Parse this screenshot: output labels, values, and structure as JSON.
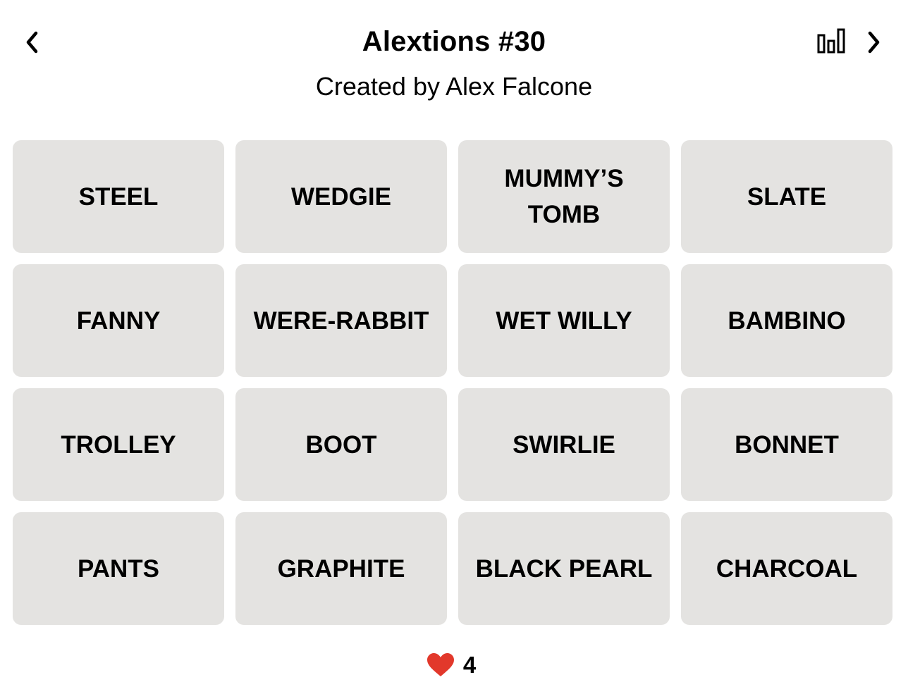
{
  "header": {
    "title": "Alextions #30",
    "subtitle": "Created by Alex Falcone",
    "prev_icon": "chevron-left-icon",
    "next_icon": "chevron-right-icon",
    "stats_icon": "bar-chart-icon"
  },
  "tiles": [
    "STEEL",
    "WEDGIE",
    "MUMMY’S TOMB",
    "SLATE",
    "FANNY",
    "WERE-RABBIT",
    "WET WILLY",
    "BAMBINO",
    "TROLLEY",
    "BOOT",
    "SWIRLIE",
    "BONNET",
    "PANTS",
    "GRAPHITE",
    "BLACK PEARL",
    "CHARCOAL"
  ],
  "lives": {
    "icon": "heart-icon",
    "count": "4",
    "color": "#e2382b"
  },
  "colors": {
    "tile_background": "#e4e3e1",
    "text": "#000000"
  }
}
